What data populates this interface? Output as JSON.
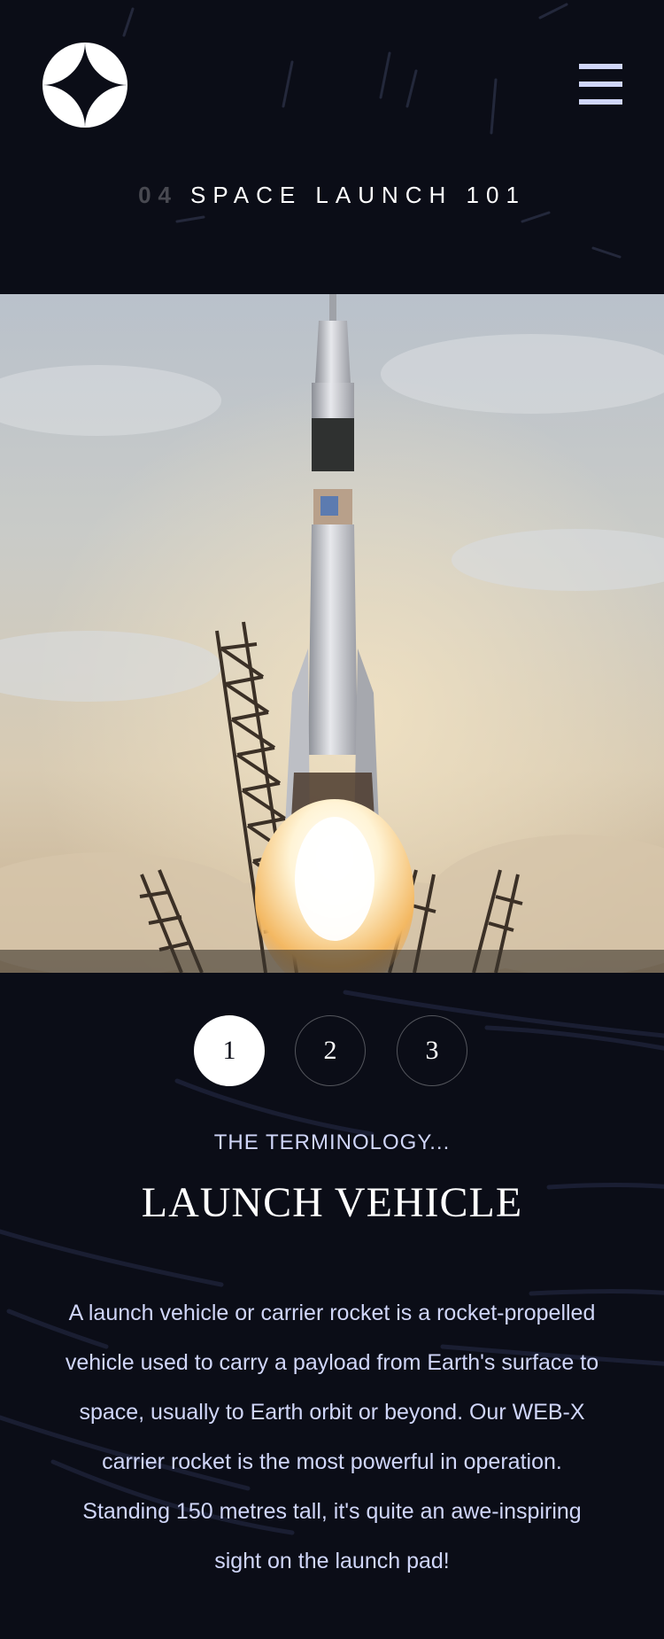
{
  "header": {
    "logo_icon": "star-logo-icon",
    "menu_icon": "hamburger-menu-icon"
  },
  "page": {
    "heading_number": "04",
    "heading_text": "SPACE LAUNCH 101"
  },
  "hero": {
    "image_subject": "rocket-launch-photo"
  },
  "pager": {
    "items": [
      "1",
      "2",
      "3"
    ],
    "active_index": 0
  },
  "content": {
    "subtitle": "THE TERMINOLOGY...",
    "title": "LAUNCH VEHICLE",
    "description": "A launch vehicle or carrier rocket is a rocket-propelled vehicle used to carry a payload from Earth's surface to space, usually to Earth orbit or beyond. Our WEB-X carrier rocket is the most powerful in operation. Standing 150 metres tall, it's quite an awe-inspiring sight on the launch pad!"
  },
  "colors": {
    "background": "#0b0d17",
    "accent": "#d0d6f9",
    "white": "#ffffff"
  }
}
